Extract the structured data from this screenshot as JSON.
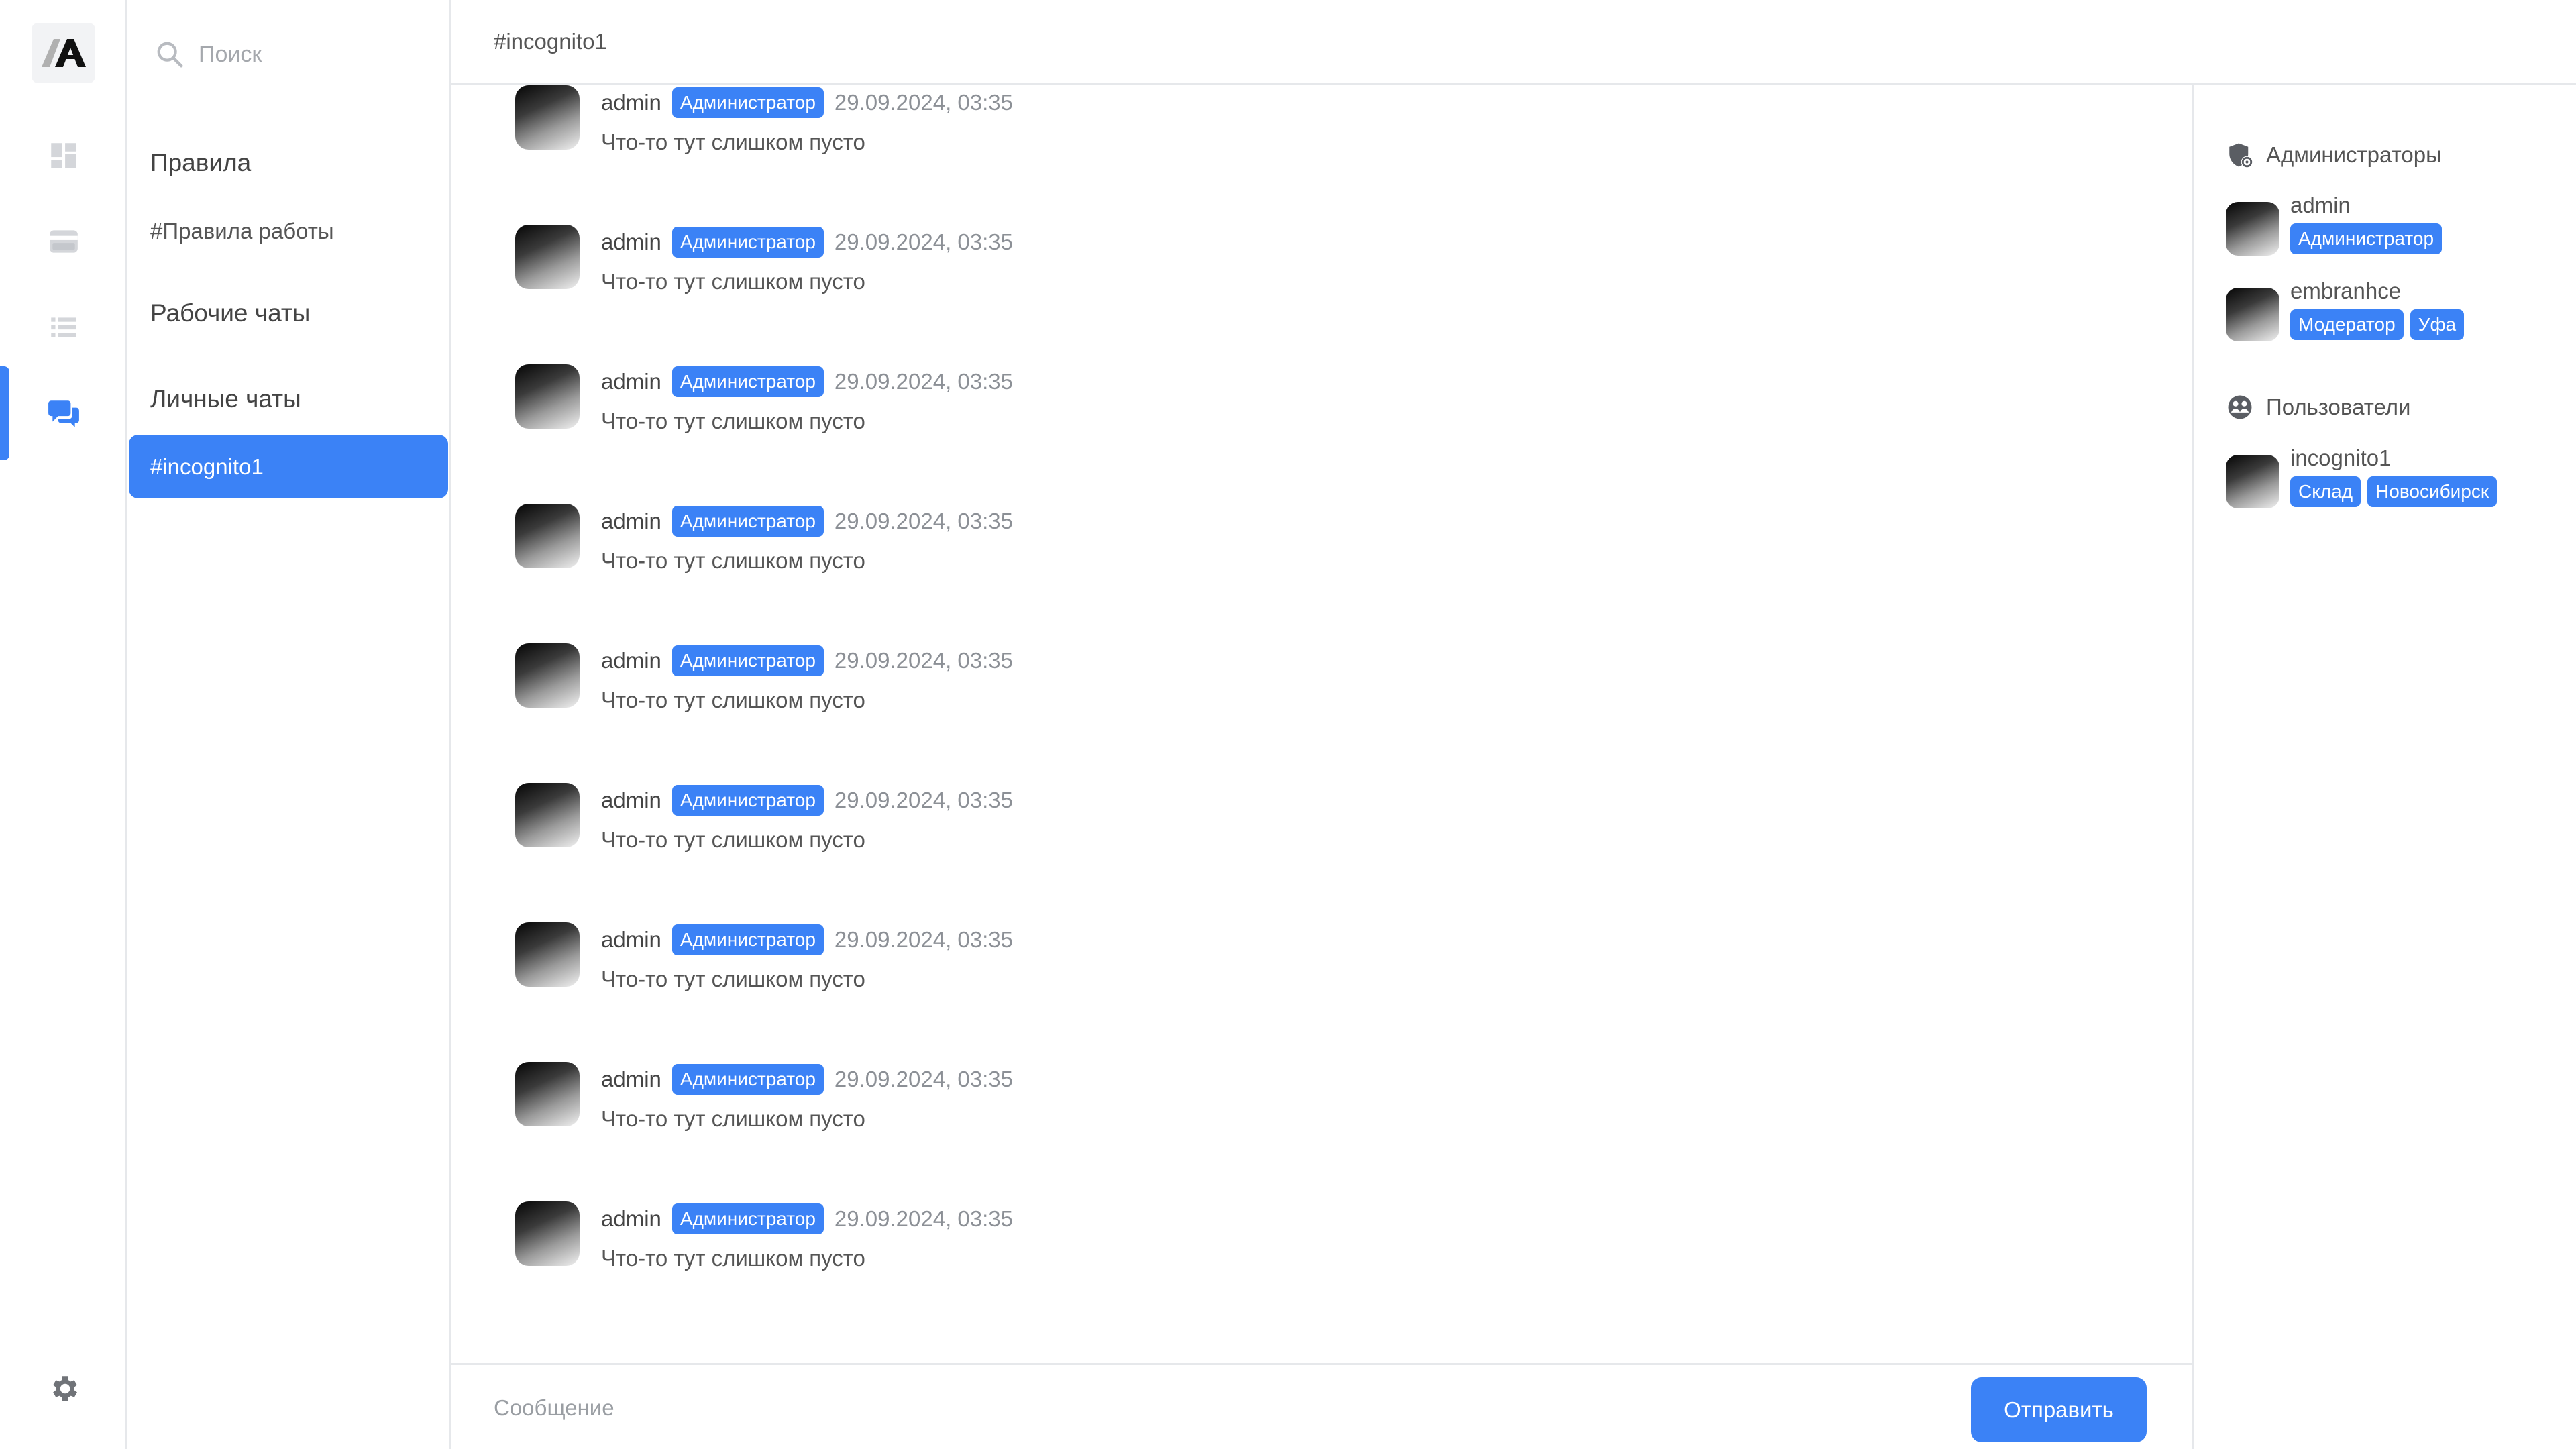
{
  "logo": {
    "text": "AA"
  },
  "search": {
    "placeholder": "Поиск"
  },
  "sidebar": {
    "rules_title": "Правила",
    "rules_channel": "#Правила работы",
    "work_chats_title": "Рабочие чаты",
    "personal_chats_title": "Личные чаты",
    "active_chat": "#incognito1"
  },
  "chat": {
    "title": "#incognito1",
    "messages": [
      {
        "author": "admin",
        "role": "Администратор",
        "time": "29.09.2024, 03:35",
        "text": "Что-то тут слишком пусто"
      },
      {
        "author": "admin",
        "role": "Администратор",
        "time": "29.09.2024, 03:35",
        "text": "Что-то тут слишком пусто"
      },
      {
        "author": "admin",
        "role": "Администратор",
        "time": "29.09.2024, 03:35",
        "text": "Что-то тут слишком пусто"
      },
      {
        "author": "admin",
        "role": "Администратор",
        "time": "29.09.2024, 03:35",
        "text": "Что-то тут слишком пусто"
      },
      {
        "author": "admin",
        "role": "Администратор",
        "time": "29.09.2024, 03:35",
        "text": "Что-то тут слишком пусто"
      },
      {
        "author": "admin",
        "role": "Администратор",
        "time": "29.09.2024, 03:35",
        "text": "Что-то тут слишком пусто"
      },
      {
        "author": "admin",
        "role": "Администратор",
        "time": "29.09.2024, 03:35",
        "text": "Что-то тут слишком пусто"
      },
      {
        "author": "admin",
        "role": "Администратор",
        "time": "29.09.2024, 03:35",
        "text": "Что-то тут слишком пусто"
      },
      {
        "author": "admin",
        "role": "Администратор",
        "time": "29.09.2024, 03:35",
        "text": "Что-то тут слишком пусто"
      }
    ]
  },
  "composer": {
    "placeholder": "Сообщение",
    "send_label": "Отправить"
  },
  "members": {
    "admins_title": "Администраторы",
    "admins": [
      {
        "name": "admin",
        "tags": [
          "Администратор"
        ]
      },
      {
        "name": "embranhce",
        "tags": [
          "Модератор",
          "Уфа"
        ]
      }
    ],
    "users_title": "Пользователи",
    "users": [
      {
        "name": "incognito1",
        "tags": [
          "Склад",
          "Новосибирск"
        ]
      }
    ]
  },
  "colors": {
    "accent": "#3b82f6",
    "icon_gray": "#d4d6da",
    "text": "#555555"
  },
  "icons": [
    "dashboard-icon",
    "wallet-icon",
    "list-icon",
    "chat-icon",
    "settings-icon",
    "search-icon",
    "shield-icon",
    "users-icon"
  ]
}
